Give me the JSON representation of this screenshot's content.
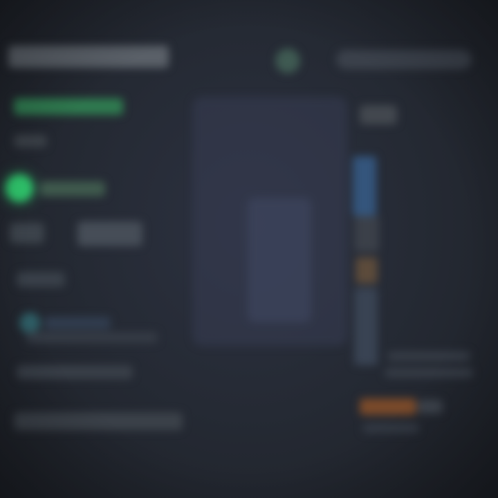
{
  "colors": {
    "background": "#252a34",
    "accent_green": "#2fc46b",
    "accent_blue": "#34557c",
    "accent_orange": "#7a4a2a"
  },
  "icons": {
    "logo": "logo-icon",
    "status": "status-dot-icon",
    "info": "info-dot-icon"
  }
}
